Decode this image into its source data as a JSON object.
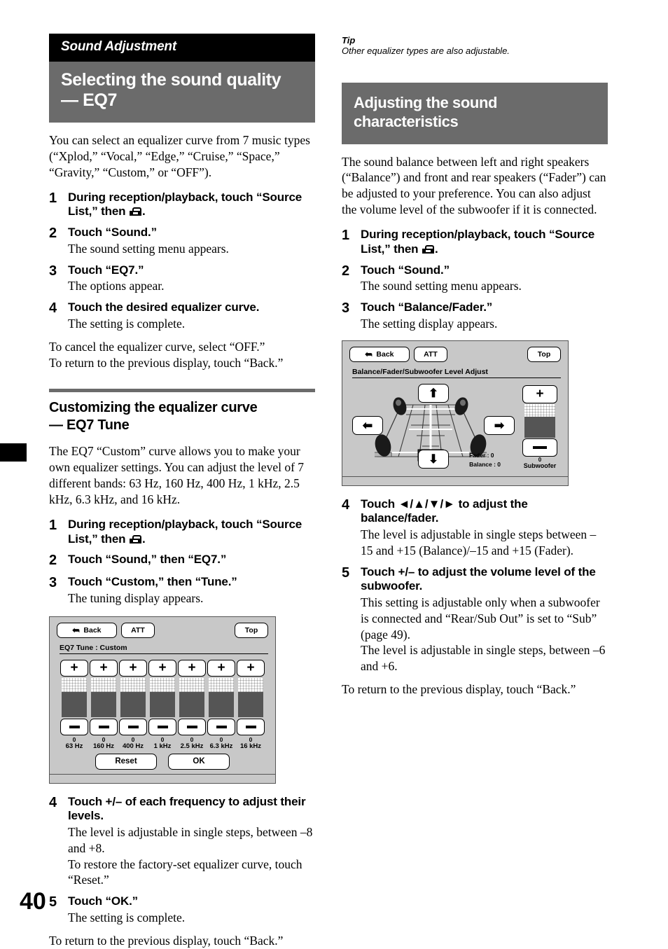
{
  "page": {
    "number": "40"
  },
  "left": {
    "chapter": "Sound Adjustment",
    "section_title": "Selecting the sound quality\n— EQ7",
    "section_line1": "Selecting the sound quality",
    "section_line2": "— EQ7",
    "intro": "You can select an equalizer curve from 7 music types (“Xplod,” “Vocal,” “Edge,” “Cruise,” “Space,” “Gravity,” “Custom,” or “OFF”).",
    "steps": [
      {
        "num": "1",
        "title_a": "During reception/playback, touch “Source List,” then",
        "title_b": ".",
        "icon": "toolbox-icon",
        "desc": ""
      },
      {
        "num": "2",
        "title": "Touch “Sound.”",
        "desc": "The sound setting menu appears."
      },
      {
        "num": "3",
        "title": "Touch “EQ7.”",
        "desc": "The options appear."
      },
      {
        "num": "4",
        "title": "Touch the desired equalizer curve.",
        "desc": "The setting is complete."
      }
    ],
    "outro_line1": "To cancel the equalizer curve, select “OFF.”",
    "outro_line2": "To return to the previous display, touch “Back.”",
    "subhead_line1": "Customizing the equalizer curve",
    "subhead_line2": "— EQ7 Tune",
    "sub_intro": "The EQ7 “Custom” curve allows you to make your own equalizer settings. You can adjust the level of 7 different bands: 63 Hz, 160 Hz, 400 Hz, 1 kHz, 2.5 kHz, 6.3 kHz, and 16 kHz.",
    "sub_steps": [
      {
        "num": "1",
        "title_a": "During reception/playback, touch “Source List,” then",
        "title_b": ".",
        "icon": "toolbox-icon",
        "desc": ""
      },
      {
        "num": "2",
        "title": "Touch “Sound,” then “EQ7.”",
        "desc": ""
      },
      {
        "num": "3",
        "title": "Touch “Custom,” then “Tune.”",
        "desc": "The tuning display appears."
      }
    ],
    "sub_steps_after": [
      {
        "num": "4",
        "title": "Touch +/– of each frequency to adjust their levels.",
        "desc": "The level is adjustable in single steps, between –8 and +8.\nTo restore the factory-set equalizer curve, touch “Reset.”"
      },
      {
        "num": "5",
        "title": "Touch “OK.”",
        "desc": "The setting is complete."
      }
    ],
    "sub_outro": "To return to the previous display, touch “Back.”"
  },
  "eq_screen": {
    "back_label": "Back",
    "back_icon": "back-arrow-icon",
    "att_label": "ATT",
    "top_label": "Top",
    "title": "EQ7 Tune : Custom",
    "plus_label": "+",
    "minus_label": "—",
    "bands": [
      {
        "value": "0",
        "freq": "63 Hz"
      },
      {
        "value": "0",
        "freq": "160 Hz"
      },
      {
        "value": "0",
        "freq": "400 Hz"
      },
      {
        "value": "0",
        "freq": "1 kHz"
      },
      {
        "value": "0",
        "freq": "2.5 kHz"
      },
      {
        "value": "0",
        "freq": "6.3 kHz"
      },
      {
        "value": "0",
        "freq": "16 kHz"
      }
    ],
    "reset_label": "Reset",
    "ok_label": "OK"
  },
  "right": {
    "tip_label": "Tip",
    "tip_text": "Other equalizer types are also adjustable.",
    "section_line1": "Adjusting the sound",
    "section_line2": "characteristics",
    "intro": "The sound balance between left and right speakers (“Balance”) and front and rear speakers (“Fader”) can be adjusted to your preference. You can also adjust the volume level of the subwoofer if it is connected.",
    "steps": [
      {
        "num": "1",
        "title_a": "During reception/playback, touch “Source List,” then",
        "title_b": ".",
        "icon": "toolbox-icon",
        "desc": ""
      },
      {
        "num": "2",
        "title": "Touch “Sound.”",
        "desc": "The sound setting menu appears."
      },
      {
        "num": "3",
        "title": "Touch “Balance/Fader.”",
        "desc": "The setting display appears."
      }
    ],
    "steps_after": [
      {
        "num": "4",
        "title_a": "Touch ",
        "arrows": "◄/▲/▼/►",
        "title_b": " to adjust the balance/fader.",
        "desc": "The level is adjustable in single steps between –15 and +15 (Balance)/–15 and +15 (Fader)."
      },
      {
        "num": "5",
        "title": "Touch +/– to adjust the volume level of the subwoofer.",
        "desc": "This setting is adjustable only when a subwoofer is connected and “Rear/Sub Out” is set to “Sub” (page 49).\nThe level is adjustable in single steps, between –6 and +6."
      }
    ],
    "outro": "To return to the previous display, touch “Back.”"
  },
  "bf_screen": {
    "back_label": "Back",
    "back_icon": "back-arrow-icon",
    "att_label": "ATT",
    "top_label": "Top",
    "title": "Balance/Fader/Subwoofer Level Adjust",
    "up_icon": "arrow-up-icon",
    "down_icon": "arrow-down-icon",
    "left_icon": "arrow-left-icon",
    "right_icon": "arrow-right-icon",
    "fader_readout": "Fader : 0",
    "balance_readout": "Balance : 0",
    "sub_plus": "+",
    "sub_minus": "—",
    "sub_value": "0",
    "sub_name": "Subwoofer"
  },
  "colors": {
    "chapter_bar": "#000000",
    "section_bar": "#6b6b6b",
    "device_bg": "#c8c8c8",
    "bar_fill": "#555555"
  }
}
